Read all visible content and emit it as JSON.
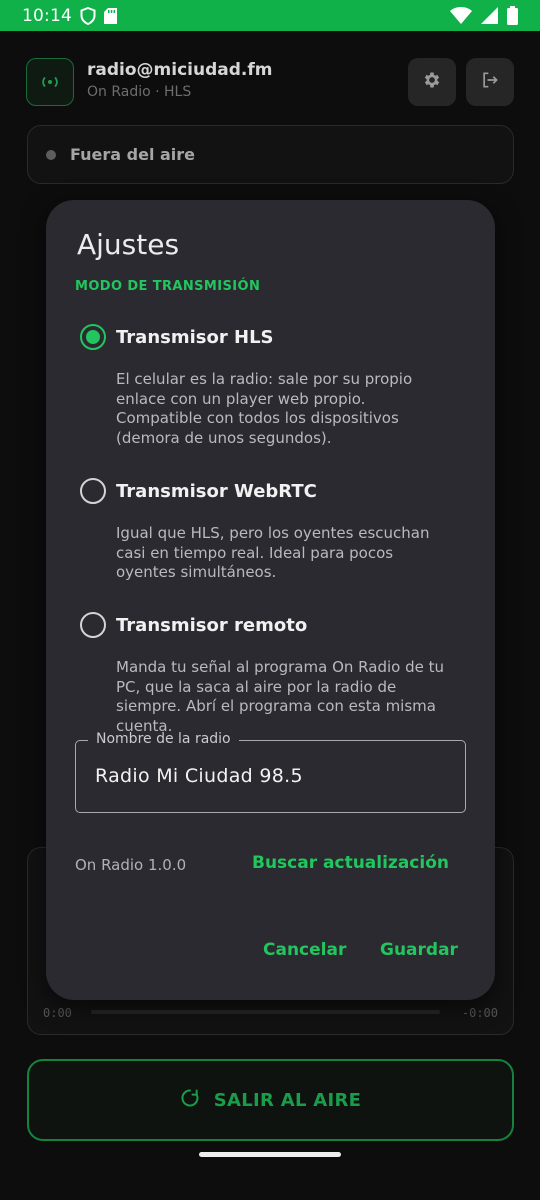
{
  "status_bar": {
    "time": "10:14",
    "icons": [
      "shield-icon",
      "sd-card-icon",
      "wifi-icon",
      "signal-icon",
      "battery-icon"
    ]
  },
  "header": {
    "email": "radio@miciudad.fm",
    "subtitle": "On Radio · HLS",
    "icons": [
      "logo-icon",
      "gear-icon",
      "logout-icon"
    ]
  },
  "status": {
    "text": "Fuera del aire"
  },
  "player": {
    "elapsed": "0:00",
    "remaining": "-0:00"
  },
  "air_button": {
    "label": "SALIR AL AIRE",
    "icon": "power-icon"
  },
  "dialog": {
    "title": "Ajustes",
    "section_label": "MODO DE TRANSMISIÓN",
    "options": [
      {
        "name": "Transmisor HLS",
        "description": "El celular es la radio: sale por su propio enlace con un player web propio. Compatible con todos los dispositivos (demora de unos segundos).",
        "selected": true
      },
      {
        "name": "Transmisor WebRTC",
        "description": "Igual que HLS, pero los oyentes escuchan casi en tiempo real. Ideal para pocos oyentes simultáneos.",
        "selected": false
      },
      {
        "name": "Transmisor remoto",
        "description": "Manda tu señal al programa On Radio de tu PC, que la saca al aire por la radio de siempre. Abrí el programa con esta misma cuenta.",
        "selected": false
      }
    ],
    "radio_name_label": "Nombre de la radio",
    "radio_name_value": "Radio Mi Ciudad 98.5",
    "version": "On Radio 1.0.0",
    "update_label": "Buscar actualización",
    "cancel_label": "Cancelar",
    "save_label": "Guardar"
  },
  "colors": {
    "accent": "#22c55e",
    "status_bar": "#11b14a",
    "dialog_bg": "#2b2a30",
    "background": "#0d0d0d"
  }
}
